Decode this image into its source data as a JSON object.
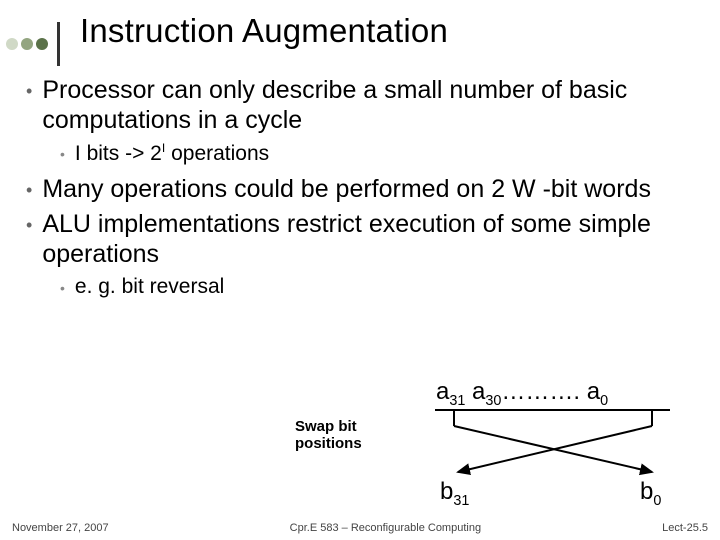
{
  "title": "Instruction Augmentation",
  "bullets": {
    "p1": "Processor can only describe a small number of basic computations in a cycle",
    "p1a_prefix": "I bits  ->   2",
    "p1a_sup": "I",
    "p1a_suffix": " operations",
    "p2": "Many operations could be performed on 2 W -bit words",
    "p3": "ALU implementations restrict execution of some simple operations",
    "p3a": "e. g. bit reversal"
  },
  "diagram": {
    "swap_line1": "Swap bit",
    "swap_line2": "positions",
    "top_a31": "a",
    "top_a31_sub": "31",
    "top_a30": " a",
    "top_a30_sub": "30",
    "top_dots": "………. a",
    "top_a0_sub": "0",
    "b31": "b",
    "b31_sub": "31",
    "b0": "b",
    "b0_sub": "0"
  },
  "footer": {
    "left": "November 27, 2007",
    "center": "Cpr.E 583 – Reconfigurable Computing",
    "right": "Lect-25.5"
  }
}
